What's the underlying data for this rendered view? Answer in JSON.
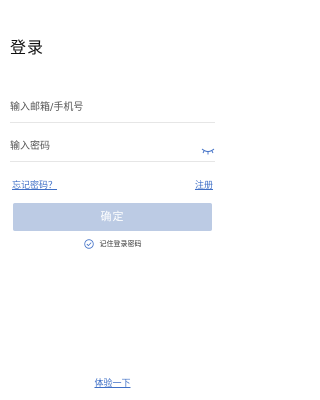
{
  "page": {
    "title": "登录"
  },
  "form": {
    "account_placeholder": "输入邮箱/手机号",
    "account_value": "",
    "password_placeholder": "输入密码",
    "password_value": "",
    "password_toggle_icon": "eye-closed-icon"
  },
  "links": {
    "forgot_password": "忘记密码？",
    "register": "注册"
  },
  "actions": {
    "confirm_label": "确定"
  },
  "remember": {
    "label": "记住登录密码",
    "checked": true,
    "icon": "check-circle-icon"
  },
  "footer": {
    "trial_label": "体验一下"
  },
  "colors": {
    "accent": "#3f6fc6",
    "button_disabled": "#bccbe4",
    "divider": "#e6e6e6"
  }
}
